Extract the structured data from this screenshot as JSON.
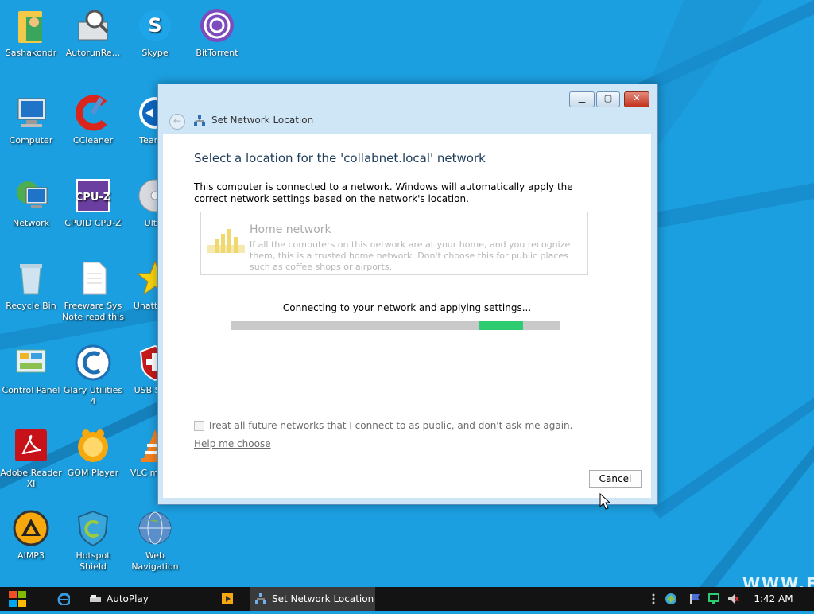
{
  "desktop": {
    "icons": [
      {
        "label": "Sashakondr",
        "icon": "user-folder-icon"
      },
      {
        "label": "AutorunRe...",
        "icon": "autorun-icon"
      },
      {
        "label": "Skype",
        "icon": "skype-icon"
      },
      {
        "label": "BitTorrent",
        "icon": "bittorrent-icon"
      },
      {
        "label": "Computer",
        "icon": "computer-icon"
      },
      {
        "label": "CCleaner",
        "icon": "ccleaner-icon"
      },
      {
        "label": "TeamVi",
        "icon": "teamviewer-icon"
      },
      {
        "label": "Network",
        "icon": "network-icon"
      },
      {
        "label": "CPUID CPU-Z",
        "icon": "cpuz-icon"
      },
      {
        "label": "Ultra",
        "icon": "disc-icon"
      },
      {
        "label": "Recycle Bin",
        "icon": "recycle-bin-icon"
      },
      {
        "label": "Freeware Sys Note read this",
        "icon": "document-icon"
      },
      {
        "label": "Unatte So",
        "icon": "star-icon"
      },
      {
        "label": "Control Panel",
        "icon": "control-panel-icon"
      },
      {
        "label": "Glary Utilities 4",
        "icon": "glary-icon"
      },
      {
        "label": "USB Secu",
        "icon": "shield-icon"
      },
      {
        "label": "Adobe Reader XI",
        "icon": "adobe-reader-icon"
      },
      {
        "label": "GOM Player",
        "icon": "gom-player-icon"
      },
      {
        "label": "VLC m play",
        "icon": "vlc-icon"
      },
      {
        "label": "AIMP3",
        "icon": "aimp-icon"
      },
      {
        "label": "Hotspot Shield",
        "icon": "hotspot-shield-icon"
      },
      {
        "label": "Web Navigation",
        "icon": "globe-icon"
      }
    ]
  },
  "window": {
    "nav_title": "Set Network Location",
    "heading": "Select a location for the 'collabnet.local' network",
    "description": "This computer is connected to a network. Windows will automatically apply the correct network settings based on the network's location.",
    "home_option": {
      "title": "Home network",
      "description": "If all the computers on this network are at your home, and you recognize them, this is a trusted home network.  Don't choose this for public places such as coffee shops or airports."
    },
    "progress_text": "Connecting to your network and applying settings...",
    "progress_indicator_position": 0.87,
    "public_checkbox_label": "Treat all future networks that I connect to as public, and don't ask me again.",
    "public_checkbox_checked": false,
    "help_link": "Help me choose",
    "cancel_label": "Cancel"
  },
  "taskbar": {
    "autoplay_label": "AutoPlay",
    "network_location_label": "Set Network Location",
    "clock": "1:42 AM"
  },
  "watermark": "WWW.FR",
  "colors": {
    "desktop_bg": "#1c9fe0",
    "progress_fill": "#2ecc71",
    "taskbar_bg": "#131313"
  }
}
